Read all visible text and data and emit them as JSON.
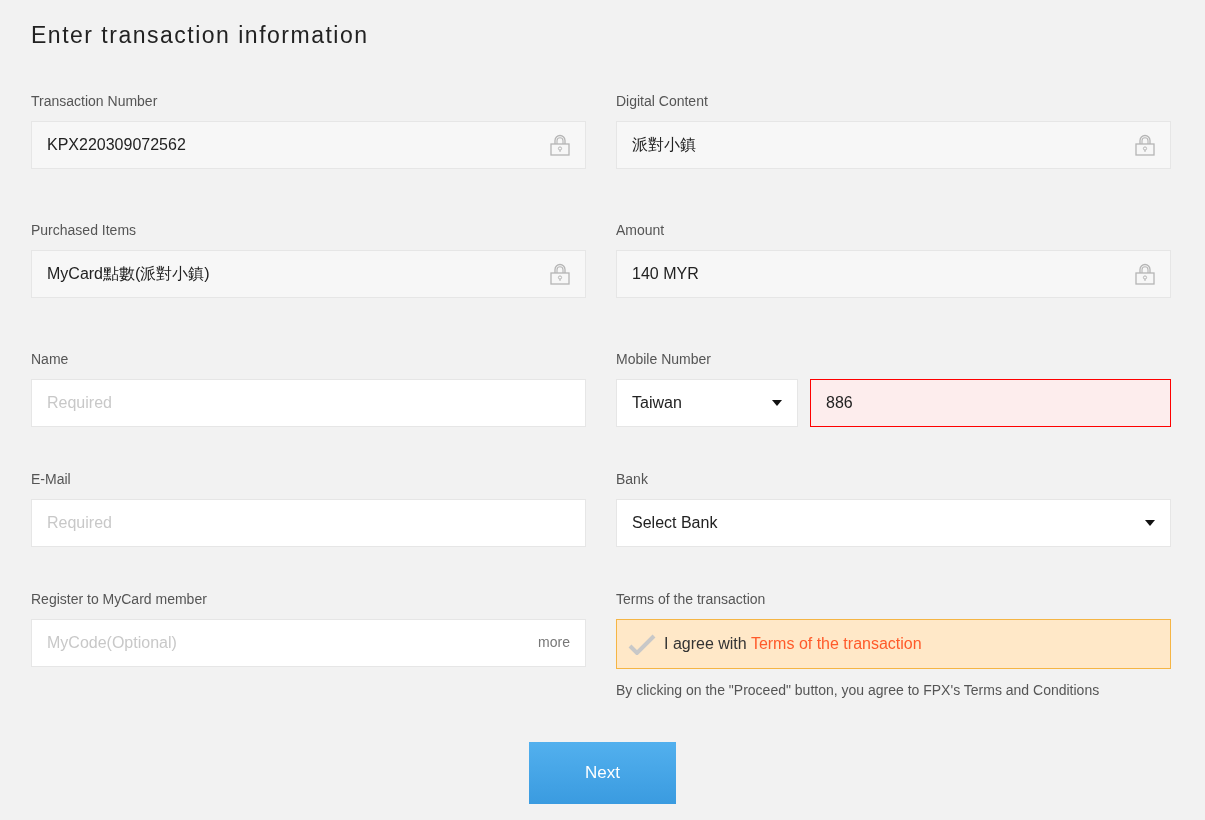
{
  "title": "Enter transaction information",
  "fields": [
    {
      "kind": "locked",
      "label": "Transaction Number",
      "value": "KPX220309072562"
    },
    {
      "kind": "locked",
      "label": "Digital Content",
      "value": "派對小鎮"
    },
    {
      "kind": "locked",
      "label": "Purchased Items",
      "value": "MyCard點數(派對小鎮)"
    },
    {
      "kind": "locked",
      "label": "Amount",
      "value": "140 MYR"
    },
    {
      "kind": "input",
      "label": "Name",
      "placeholder": "Required"
    },
    {
      "kind": "phone",
      "label": "Mobile Number",
      "country": "Taiwan",
      "value": "886",
      "error": true
    },
    {
      "kind": "input",
      "label": "E-Mail",
      "placeholder": "Required"
    },
    {
      "kind": "select",
      "label": "Bank",
      "value": "Select Bank"
    },
    {
      "kind": "code",
      "label": "Register to MyCard member",
      "placeholder": "MyCode(Optional)",
      "more": "more"
    },
    {
      "kind": "terms",
      "label": "Terms of the transaction",
      "checked": false,
      "prefix": "I agree with",
      "link": "Terms of the transaction",
      "note": "By clicking on the \"Proceed\" button, you agree to FPX's Terms and Conditions"
    }
  ],
  "next_button": "Next"
}
